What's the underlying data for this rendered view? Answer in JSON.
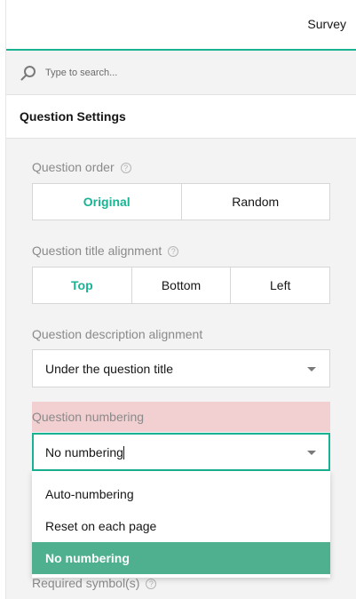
{
  "header": {
    "tab_label": "Survey"
  },
  "search": {
    "placeholder": "Type to search..."
  },
  "section": {
    "title": "Question Settings"
  },
  "settings": {
    "question_order": {
      "label": "Question order",
      "options": [
        "Original",
        "Random"
      ],
      "selected": "Original"
    },
    "title_alignment": {
      "label": "Question title alignment",
      "options": [
        "Top",
        "Bottom",
        "Left"
      ],
      "selected": "Top"
    },
    "description_alignment": {
      "label": "Question description alignment",
      "value": "Under the question title"
    },
    "numbering": {
      "label": "Question numbering",
      "value": "No numbering",
      "options": [
        "Auto-numbering",
        "Reset on each page",
        "No numbering"
      ],
      "selected": "No numbering"
    },
    "required_symbol": {
      "label": "Required symbol(s)"
    }
  },
  "help_glyph": "?",
  "colors": {
    "accent": "#19b394",
    "error_bg": "#f2d0d1",
    "selected_item": "#4eb08e",
    "panel_bg": "#f3f3f3"
  }
}
